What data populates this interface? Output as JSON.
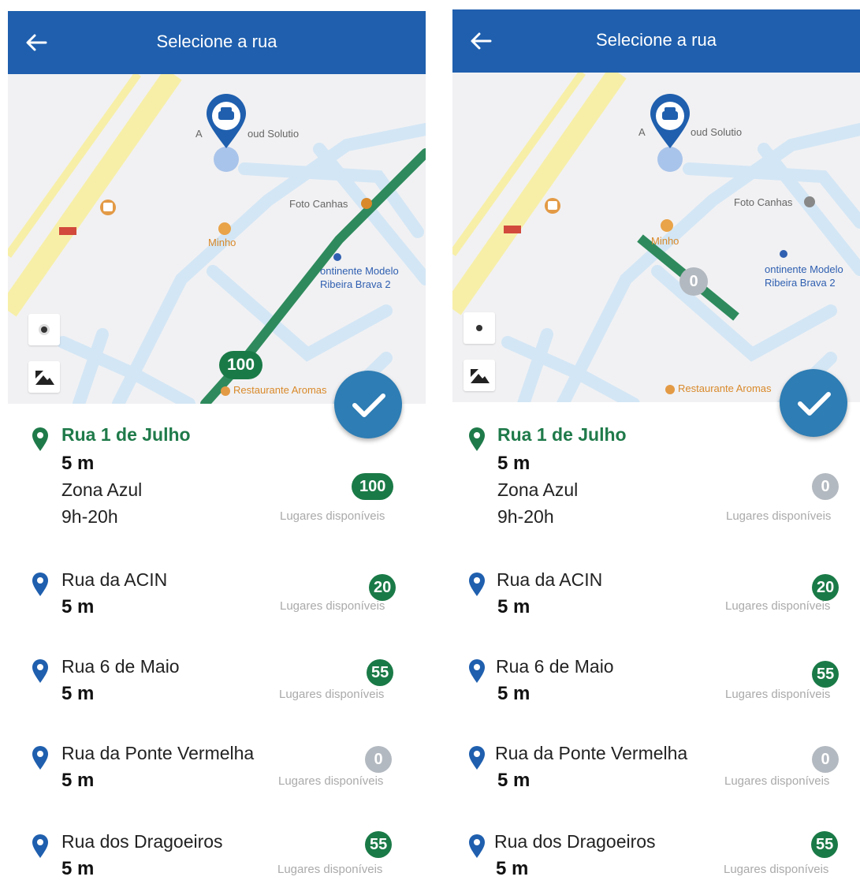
{
  "colors": {
    "header": "#1f5fae",
    "selected": "#1f7a4a",
    "available": "#1a7a47",
    "empty": "#b3b9c0",
    "fab": "#2e7db4",
    "route": "#2e8a5c"
  },
  "screens": [
    {
      "header_title": "Selecione a rua",
      "map": {
        "pois": [
          "ACIN Cloud Solutions",
          "Foto Canhas",
          "Minho",
          "Continente Modelo Ribeira Brava 2",
          "Restaurante Aromas"
        ],
        "poi_visible": [
          "A",
          "oud Solutio",
          "Foto Canhas",
          "Minho",
          "ontinente Modelo",
          "Ribeira Brava 2",
          "Restaurante Aromas"
        ],
        "segment_badge": "100"
      },
      "streets": [
        {
          "name": "Rua 1 de Julho",
          "distance": "5 m",
          "zone": "Zona Azul",
          "hours": "9h-20h",
          "available": "100",
          "label": "Lugares disponíveis",
          "selected": true
        },
        {
          "name": "Rua da ACIN",
          "distance": "5 m",
          "available": "20",
          "label": "Lugares disponíveis"
        },
        {
          "name": "Rua 6 de Maio",
          "distance": "5 m",
          "available": "55",
          "label": "Lugares disponíveis"
        },
        {
          "name": "Rua da Ponte Vermelha",
          "distance": "5 m",
          "available": "0",
          "label": "Lugares disponíveis"
        },
        {
          "name": "Rua dos Dragoeiros",
          "distance": "5 m",
          "available": "55",
          "label": "Lugares disponíveis"
        }
      ]
    },
    {
      "header_title": "Selecione a rua",
      "map": {
        "poi_visible": [
          "A",
          "oud Solutio",
          "Foto Canhas",
          "Minho",
          "ontinente Modelo",
          "Ribeira Brava 2",
          "Restaurante Aromas"
        ],
        "segment_badge": "0"
      },
      "streets": [
        {
          "name": "Rua 1 de Julho",
          "distance": "5 m",
          "zone": "Zona Azul",
          "hours": "9h-20h",
          "available": "0",
          "label": "Lugares disponíveis",
          "selected": true
        },
        {
          "name": "Rua da ACIN",
          "distance": "5 m",
          "available": "20",
          "label": "Lugares disponíveis"
        },
        {
          "name": "Rua 6 de Maio",
          "distance": "5 m",
          "available": "55",
          "label": "Lugares disponíveis"
        },
        {
          "name": "Rua da Ponte Vermelha",
          "distance": "5 m",
          "available": "0",
          "label": "Lugares disponíveis"
        },
        {
          "name": "Rua dos Dragoeiros",
          "distance": "5 m",
          "available": "55",
          "label": "Lugares disponíveis"
        }
      ]
    }
  ]
}
